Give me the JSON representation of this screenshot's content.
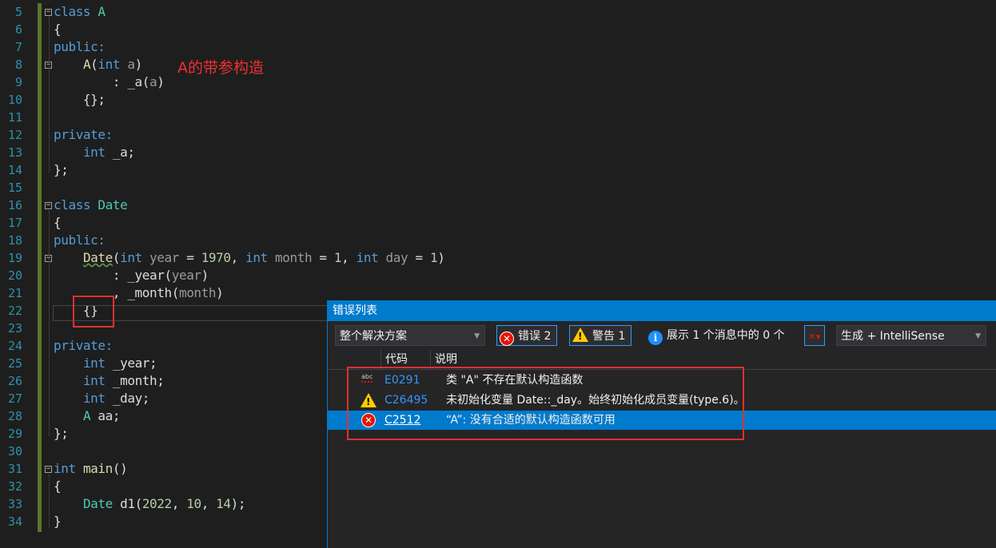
{
  "editor": {
    "annotation": "A的带参构造",
    "lines": [
      {
        "n": "5",
        "t": [
          [
            "class ",
            "kw"
          ],
          [
            "A",
            "ty"
          ]
        ]
      },
      {
        "n": "6",
        "t": [
          [
            "{",
            ""
          ]
        ]
      },
      {
        "n": "7",
        "t": [
          [
            "public:",
            "kw"
          ]
        ]
      },
      {
        "n": "8",
        "t": [
          [
            "    ",
            ""
          ],
          [
            "A",
            "fn"
          ],
          [
            "(",
            ""
          ],
          [
            "int ",
            "kw"
          ],
          [
            "a",
            "pa"
          ],
          [
            ")",
            ""
          ]
        ]
      },
      {
        "n": "9",
        "t": [
          [
            "        : _a(",
            ""
          ],
          [
            "a",
            "pa"
          ],
          [
            ")",
            ""
          ]
        ]
      },
      {
        "n": "10",
        "t": [
          [
            "    {};",
            ""
          ]
        ]
      },
      {
        "n": "11",
        "t": []
      },
      {
        "n": "12",
        "t": [
          [
            "private:",
            "kw"
          ]
        ]
      },
      {
        "n": "13",
        "t": [
          [
            "    ",
            ""
          ],
          [
            "int ",
            "kw"
          ],
          [
            "_a;",
            ""
          ]
        ]
      },
      {
        "n": "14",
        "t": [
          [
            "};",
            ""
          ]
        ]
      },
      {
        "n": "15",
        "t": []
      },
      {
        "n": "16",
        "t": [
          [
            "class ",
            "kw"
          ],
          [
            "Date",
            "ty"
          ]
        ]
      },
      {
        "n": "17",
        "t": [
          [
            "{",
            ""
          ]
        ]
      },
      {
        "n": "18",
        "t": [
          [
            "public:",
            "kw"
          ]
        ]
      },
      {
        "n": "19",
        "t": [
          [
            "    ",
            ""
          ],
          [
            "Date",
            "fn sq"
          ],
          [
            "(",
            ""
          ],
          [
            "int ",
            "kw"
          ],
          [
            "year",
            "pa"
          ],
          [
            " = ",
            ""
          ],
          [
            "1970",
            "nu"
          ],
          [
            ", ",
            ""
          ],
          [
            "int ",
            "kw"
          ],
          [
            "month",
            "pa"
          ],
          [
            " = ",
            ""
          ],
          [
            "1",
            "nu"
          ],
          [
            ", ",
            ""
          ],
          [
            "int ",
            "kw"
          ],
          [
            "day",
            "pa"
          ],
          [
            " = ",
            ""
          ],
          [
            "1",
            "nu"
          ],
          [
            ")",
            ""
          ]
        ]
      },
      {
        "n": "20",
        "t": [
          [
            "        : _year(",
            ""
          ],
          [
            "year",
            "pa"
          ],
          [
            ")",
            ""
          ]
        ]
      },
      {
        "n": "21",
        "t": [
          [
            "        , _month(",
            ""
          ],
          [
            "month",
            "pa"
          ],
          [
            ")",
            ""
          ]
        ]
      },
      {
        "n": "22",
        "t": [
          [
            "    {}",
            ""
          ]
        ]
      },
      {
        "n": "23",
        "t": []
      },
      {
        "n": "24",
        "t": [
          [
            "private:",
            "kw"
          ]
        ]
      },
      {
        "n": "25",
        "t": [
          [
            "    ",
            ""
          ],
          [
            "int ",
            "kw"
          ],
          [
            "_year;",
            ""
          ]
        ]
      },
      {
        "n": "26",
        "t": [
          [
            "    ",
            ""
          ],
          [
            "int ",
            "kw"
          ],
          [
            "_month;",
            ""
          ]
        ]
      },
      {
        "n": "27",
        "t": [
          [
            "    ",
            ""
          ],
          [
            "int ",
            "kw"
          ],
          [
            "_day;",
            ""
          ]
        ]
      },
      {
        "n": "28",
        "t": [
          [
            "    ",
            ""
          ],
          [
            "A ",
            "ty"
          ],
          [
            "aa;",
            ""
          ]
        ]
      },
      {
        "n": "29",
        "t": [
          [
            "};",
            ""
          ]
        ]
      },
      {
        "n": "30",
        "t": []
      },
      {
        "n": "31",
        "t": [
          [
            "int ",
            "kw"
          ],
          [
            "main",
            "fn"
          ],
          [
            "()",
            ""
          ]
        ]
      },
      {
        "n": "32",
        "t": [
          [
            "{",
            ""
          ]
        ]
      },
      {
        "n": "33",
        "t": [
          [
            "    ",
            ""
          ],
          [
            "Date ",
            "ty"
          ],
          [
            "d1(",
            ""
          ],
          [
            "2022",
            "nu"
          ],
          [
            ", ",
            ""
          ],
          [
            "10",
            "nu"
          ],
          [
            ", ",
            ""
          ],
          [
            "14",
            "nu"
          ],
          [
            ");",
            ""
          ]
        ]
      },
      {
        "n": "34",
        "t": [
          [
            "}",
            ""
          ]
        ]
      }
    ]
  },
  "error_list": {
    "title": "错误列表",
    "scope": "整个解决方案",
    "errors_label": "错误 2",
    "warnings_label": "警告 1",
    "messages_label": "展示 1 个消息中的 0 个",
    "source": "生成 + IntelliSense",
    "columns": {
      "code": "代码",
      "description": "说明"
    },
    "rows": [
      {
        "icon": "spell-squiggle-icon",
        "code": "E0291",
        "description": "类 \"A\" 不存在默认构造函数",
        "selected": false
      },
      {
        "icon": "warning-icon",
        "code": "C26495",
        "description": "未初始化变量 Date::_day。始终初始化成员变量(type.6)。",
        "selected": false
      },
      {
        "icon": "error-icon",
        "code": "C2512",
        "description": "“A”: 没有合适的默认构造函数可用",
        "selected": true
      }
    ]
  }
}
